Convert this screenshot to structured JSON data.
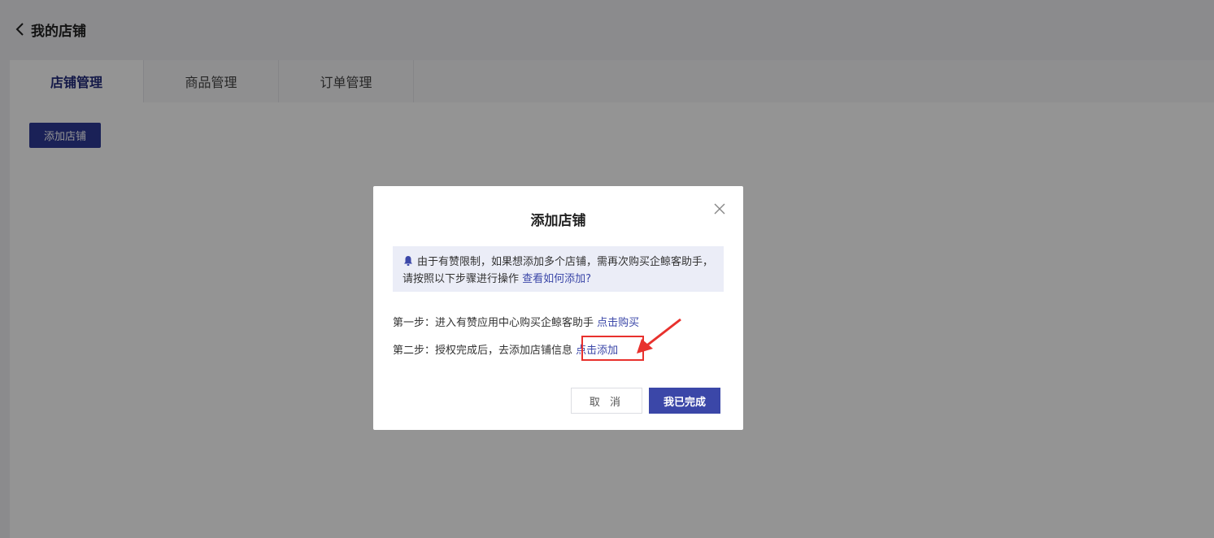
{
  "header": {
    "title": "我的店铺",
    "back_icon": "chevron-left-icon"
  },
  "tabs": [
    {
      "label": "店铺管理",
      "active": true
    },
    {
      "label": "商品管理",
      "active": false
    },
    {
      "label": "订单管理",
      "active": false
    }
  ],
  "toolbar": {
    "add_shop_label": "添加店铺"
  },
  "modal": {
    "title": "添加店铺",
    "close_icon": "close-icon",
    "notice": {
      "icon": "bell-icon",
      "text": "由于有赞限制，如果想添加多个店铺，需再次购买企鲸客助手，请按照以下步骤进行操作",
      "link": "查看如何添加?"
    },
    "step1": {
      "text": "第一步：进入有赞应用中心购买企鲸客助手",
      "link": "点击购买"
    },
    "step2": {
      "text": "第二步：授权完成后，去添加店铺信息",
      "link": "点击添加"
    },
    "cancel_label": "取 消",
    "done_label": "我已完成"
  },
  "colors": {
    "primary": "#3b47a8",
    "highlight": "#e8312d",
    "notice_bg": "#ebedf7"
  }
}
